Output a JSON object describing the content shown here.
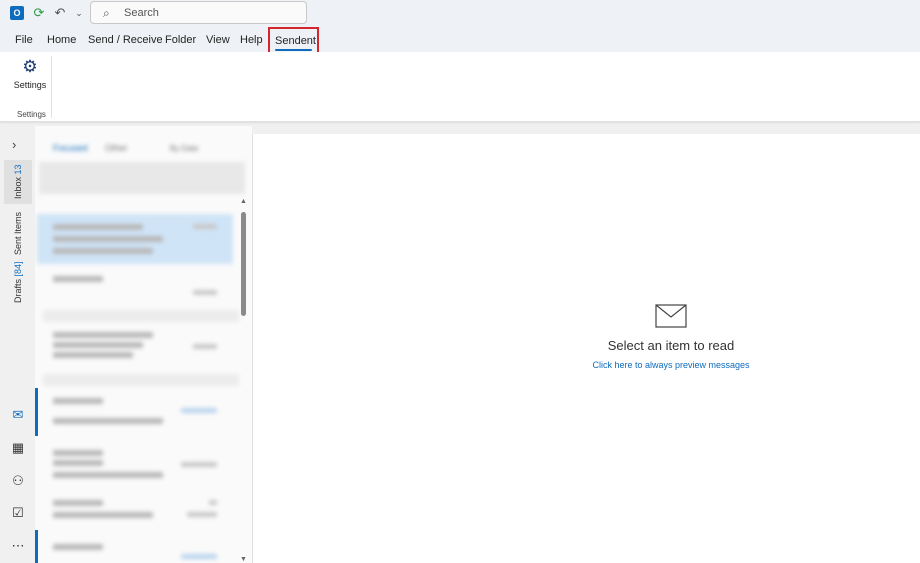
{
  "titlebar": {
    "app_icon": "outlook-icon",
    "quick_access": [
      "sync-icon",
      "undo-icon",
      "customize-icon"
    ],
    "search": {
      "placeholder": "Search",
      "value": ""
    }
  },
  "menu": {
    "tabs": [
      {
        "label": "File"
      },
      {
        "label": "Home"
      },
      {
        "label": "Send / Receive"
      },
      {
        "label": "Folder"
      },
      {
        "label": "View"
      },
      {
        "label": "Help"
      },
      {
        "label": "Sendent"
      }
    ],
    "active_tab": "Sendent",
    "highlight_color": "#d6262d"
  },
  "ribbon": {
    "settings_button": {
      "label": "Settings",
      "icon": "gear-icon"
    },
    "group_label": "Settings"
  },
  "rail": {
    "expand_icon": "chevron-right-icon",
    "folders": [
      {
        "label": "Inbox",
        "count": "13"
      },
      {
        "label": "Sent Items",
        "count": ""
      },
      {
        "label": "Drafts",
        "count": "[84]"
      }
    ],
    "nav_icons": [
      "mail-icon",
      "calendar-icon",
      "people-icon",
      "tasks-icon",
      "more-icon"
    ]
  },
  "message_list": {
    "tab_focused": "Focused",
    "tab_other": "Other",
    "sort_label": "By Date"
  },
  "reading_pane": {
    "icon": "envelope-icon",
    "title": "Select an item to read",
    "link": "Click here to always preview messages"
  },
  "colors": {
    "accent": "#0f6cbd",
    "selected_row": "#cfe4f7"
  }
}
